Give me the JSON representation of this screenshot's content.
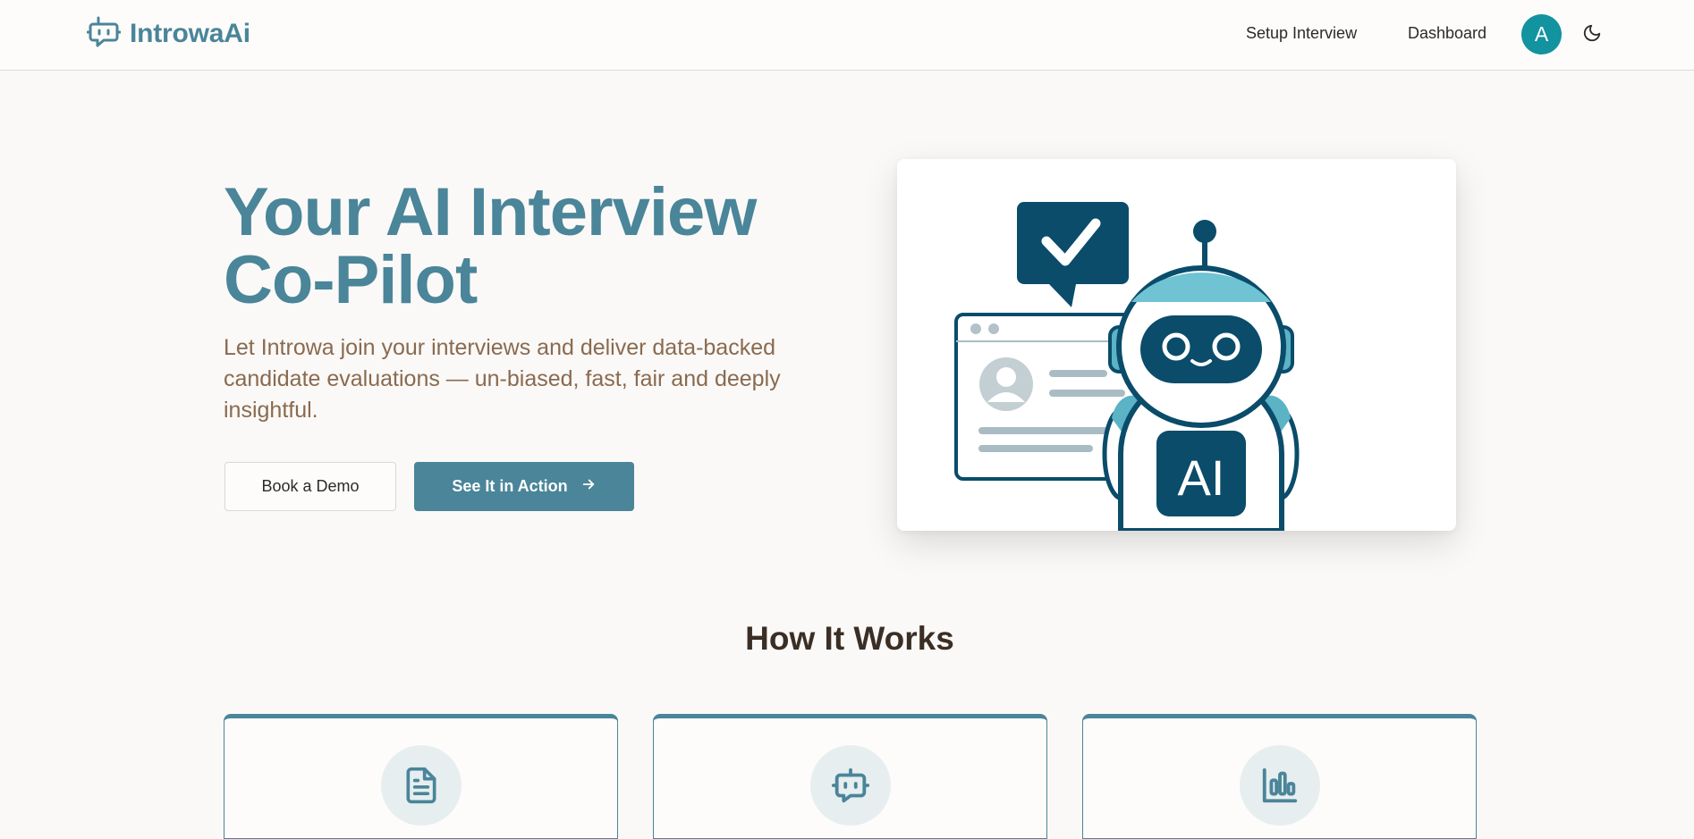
{
  "app": {
    "name": "IntrowaAi",
    "logo_icon": "bot-message-icon"
  },
  "nav": {
    "setup_label": "Setup Interview",
    "dashboard_label": "Dashboard",
    "avatar_initial": "A",
    "theme_icon": "moon-icon"
  },
  "hero": {
    "title_line1": "Your AI Interview",
    "title_line2": "Co-Pilot",
    "subtitle": "Let Introwa join your interviews and deliver data-backed candidate evaluations — un-biased, fast, fair and deeply insightful.",
    "demo_label": "Book a Demo",
    "action_label": "See It in Action",
    "action_icon": "arrow-right-icon",
    "illustration_text": "AI"
  },
  "how": {
    "title": "How It Works",
    "cards": [
      {
        "icon": "document-icon"
      },
      {
        "icon": "bot-icon"
      },
      {
        "icon": "bar-chart-icon"
      }
    ]
  },
  "colors": {
    "brand": "#4a8599",
    "avatar": "#12939f",
    "subtitle": "#8a6a4f",
    "background": "#faf9f7"
  }
}
